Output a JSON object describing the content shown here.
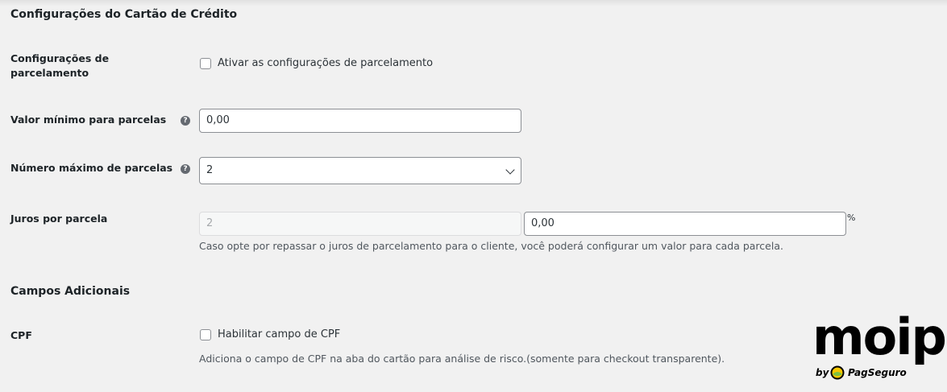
{
  "section_credit": {
    "title": "Configurações do Cartão de Crédito"
  },
  "installments_settings": {
    "label_line1": "Configurações de",
    "label_line2": "parcelamento",
    "checkbox_label": "Ativar as configurações de parcelamento",
    "checked": false
  },
  "min_installment": {
    "label": "Valor mínimo para parcelas",
    "value": "0,00",
    "help_icon": "question-icon"
  },
  "max_installments": {
    "label": "Número máximo de parcelas",
    "selected": "2",
    "help_icon": "question-icon"
  },
  "interest": {
    "label": "Juros por parcela",
    "installment_number": "2",
    "rate_value": "0,00",
    "percent_sign": "%",
    "description": "Caso opte por repassar o juros de parcelamento para o cliente, você poderá configurar um valor para cada parcela."
  },
  "section_additional": {
    "title": "Campos Adicionais"
  },
  "cpf": {
    "label": "CPF",
    "checkbox_label": "Habilitar campo de CPF",
    "checked": false,
    "description": "Adiciona o campo de CPF na aba do cartão para análise de risco.(somente para checkout transparente)."
  },
  "logo": {
    "word": "moip",
    "by": "by",
    "brand": "PagSeguro"
  },
  "colors": {
    "background": "#f1f1f1",
    "text": "#1d2327",
    "border": "#8c8f94",
    "pagseguro_green": "#7ac143",
    "pagseguro_yellow": "#f6c700"
  }
}
